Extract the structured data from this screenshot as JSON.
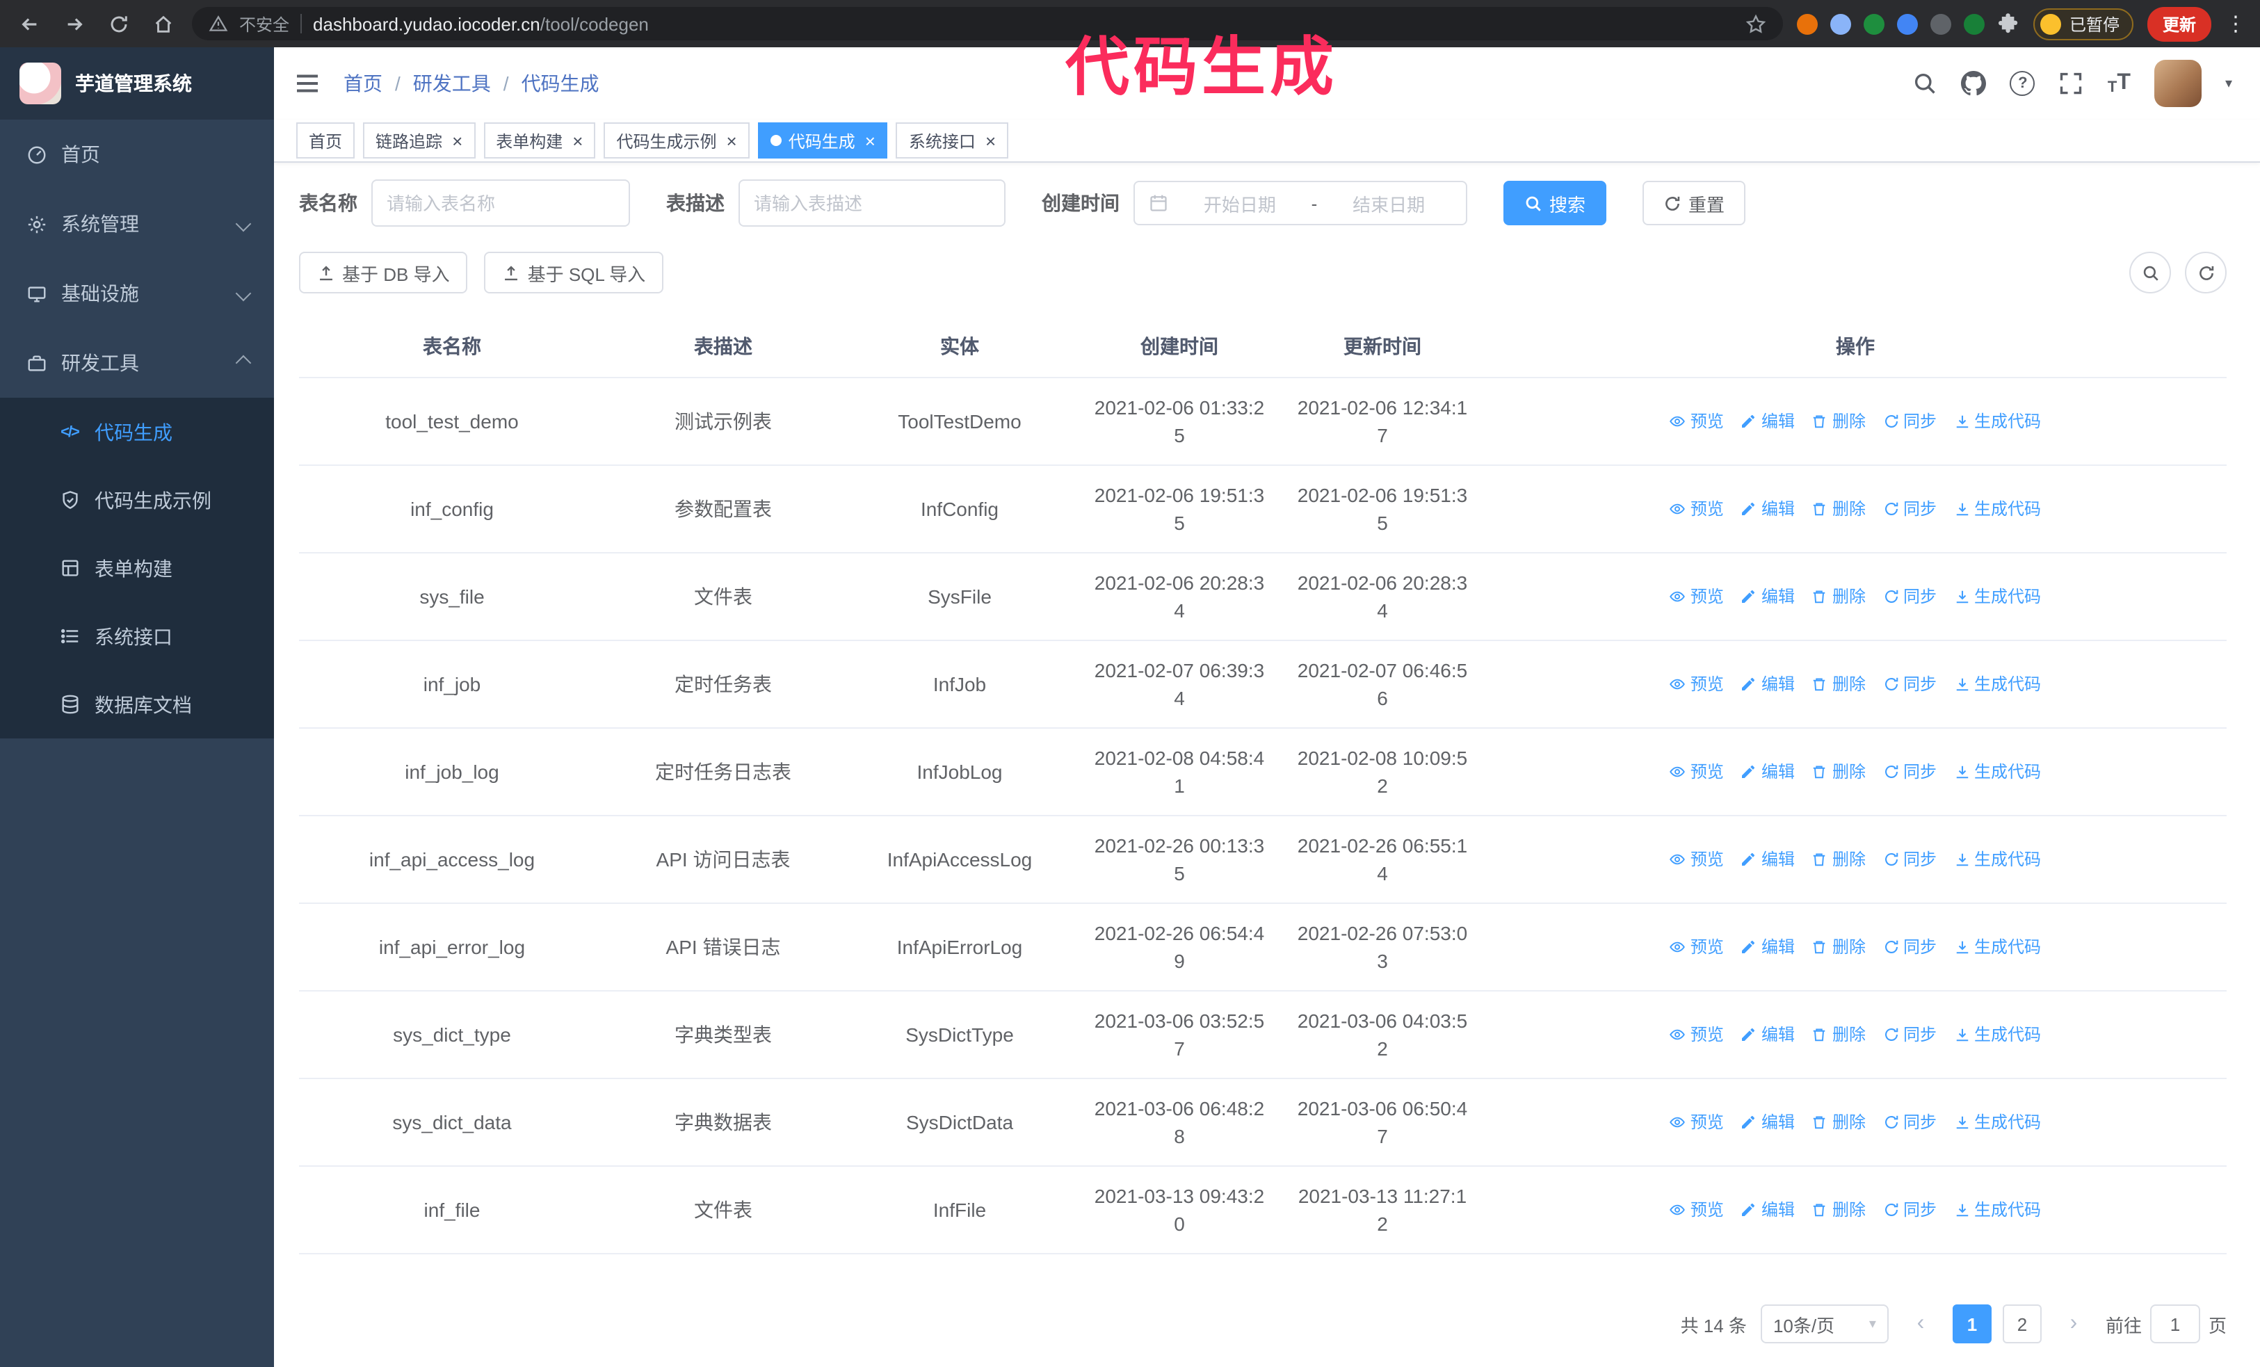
{
  "annotation": {
    "text": "代码生成"
  },
  "glyphs": {
    "close": "×",
    "prev": "‹",
    "next": "›",
    "caret": "▾",
    "kebab": "⋮",
    "code": "</>",
    "slash": "/",
    "question": "?",
    "size": "T"
  },
  "browser": {
    "security_label": "不安全",
    "url_host": "dashboard.yudao.iocoder.cn",
    "url_path": "/tool/codegen",
    "paused_badge": "已暂停",
    "update_button": "更新"
  },
  "sidebar": {
    "logo_title": "芋道管理系统",
    "items": [
      {
        "label": "首页"
      },
      {
        "label": "系统管理"
      },
      {
        "label": "基础设施"
      },
      {
        "label": "研发工具"
      }
    ],
    "submenu": [
      {
        "label": "代码生成",
        "active": true
      },
      {
        "label": "代码生成示例"
      },
      {
        "label": "表单构建"
      },
      {
        "label": "系统接口"
      },
      {
        "label": "数据库文档"
      }
    ]
  },
  "header": {
    "breadcrumb": [
      "首页",
      "研发工具",
      "代码生成"
    ]
  },
  "tabs": [
    {
      "label": "首页",
      "closable": false
    },
    {
      "label": "链路追踪",
      "closable": true
    },
    {
      "label": "表单构建",
      "closable": true
    },
    {
      "label": "代码生成示例",
      "closable": true
    },
    {
      "label": "代码生成",
      "closable": true,
      "active": true
    },
    {
      "label": "系统接口",
      "closable": true
    }
  ],
  "filters": {
    "table_name_label": "表名称",
    "table_name_placeholder": "请输入表名称",
    "table_desc_label": "表描述",
    "table_desc_placeholder": "请输入表描述",
    "create_time_label": "创建时间",
    "date_start_placeholder": "开始日期",
    "date_separator": "-",
    "date_end_placeholder": "结束日期",
    "search_button": "搜索",
    "reset_button": "重置"
  },
  "toolbar": {
    "import_db_button": "基于 DB 导入",
    "import_sql_button": "基于 SQL 导入"
  },
  "table": {
    "columns": [
      "表名称",
      "表描述",
      "实体",
      "创建时间",
      "更新时间",
      "操作"
    ],
    "actions": [
      {
        "key": "preview",
        "label": "预览"
      },
      {
        "key": "edit",
        "label": "编辑"
      },
      {
        "key": "delete",
        "label": "删除"
      },
      {
        "key": "sync",
        "label": "同步"
      },
      {
        "key": "generate",
        "label": "生成代码"
      }
    ],
    "rows": [
      {
        "name": "tool_test_demo",
        "desc": "测试示例表",
        "entity": "ToolTestDemo",
        "created": "2021-02-06 01:33:25",
        "updated": "2021-02-06 12:34:17"
      },
      {
        "name": "inf_config",
        "desc": "参数配置表",
        "entity": "InfConfig",
        "created": "2021-02-06 19:51:35",
        "updated": "2021-02-06 19:51:35"
      },
      {
        "name": "sys_file",
        "desc": "文件表",
        "entity": "SysFile",
        "created": "2021-02-06 20:28:34",
        "updated": "2021-02-06 20:28:34"
      },
      {
        "name": "inf_job",
        "desc": "定时任务表",
        "entity": "InfJob",
        "created": "2021-02-07 06:39:34",
        "updated": "2021-02-07 06:46:56"
      },
      {
        "name": "inf_job_log",
        "desc": "定时任务日志表",
        "entity": "InfJobLog",
        "created": "2021-02-08 04:58:41",
        "updated": "2021-02-08 10:09:52"
      },
      {
        "name": "inf_api_access_log",
        "desc": "API 访问日志表",
        "entity": "InfApiAccessLog",
        "created": "2021-02-26 00:13:35",
        "updated": "2021-02-26 06:55:14"
      },
      {
        "name": "inf_api_error_log",
        "desc": "API 错误日志",
        "entity": "InfApiErrorLog",
        "created": "2021-02-26 06:54:49",
        "updated": "2021-02-26 07:53:03"
      },
      {
        "name": "sys_dict_type",
        "desc": "字典类型表",
        "entity": "SysDictType",
        "created": "2021-03-06 03:52:57",
        "updated": "2021-03-06 04:03:52"
      },
      {
        "name": "sys_dict_data",
        "desc": "字典数据表",
        "entity": "SysDictData",
        "created": "2021-03-06 06:48:28",
        "updated": "2021-03-06 06:50:47"
      },
      {
        "name": "inf_file",
        "desc": "文件表",
        "entity": "InfFile",
        "created": "2021-03-13 09:43:20",
        "updated": "2021-03-13 11:27:12"
      }
    ]
  },
  "pagination": {
    "total_text": "共 14 条",
    "page_size": "10条/页",
    "pages": [
      "1",
      "2"
    ],
    "active_page": "1",
    "goto_label": "前往",
    "goto_value": "1",
    "goto_suffix": "页"
  }
}
